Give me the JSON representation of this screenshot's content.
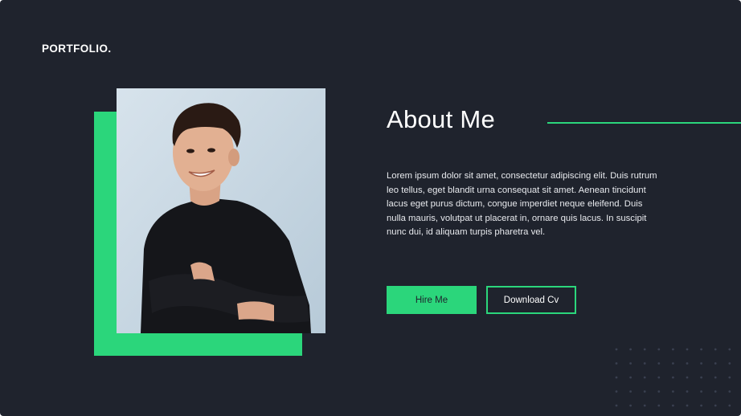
{
  "brand": {
    "logo_text": "PORTFOLIO."
  },
  "about": {
    "heading": "About Me",
    "paragraph": "Lorem ipsum dolor sit amet, consectetur adipiscing elit. Duis rutrum leo tellus, eget blandit urna consequat sit amet. Aenean tincidunt lacus eget purus dictum, congue imperdiet neque eleifend. Duis nulla mauris, volutpat ut placerat in, ornare quis lacus. In suscipit nunc dui, id aliquam turpis pharetra vel."
  },
  "actions": {
    "hire_label": "Hire Me",
    "download_label": "Download Cv"
  },
  "colors": {
    "background": "#1f232d",
    "accent": "#2bd67b",
    "text": "#ffffff"
  }
}
